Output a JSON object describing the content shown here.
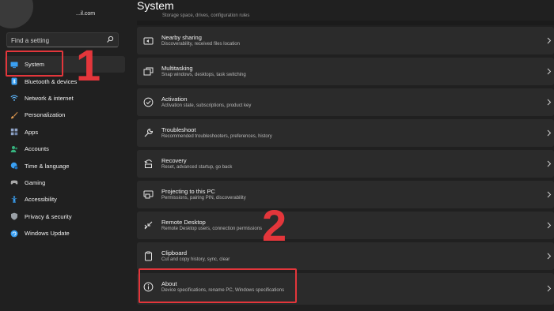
{
  "account": {
    "email": "...il.com"
  },
  "search": {
    "placeholder": "Find a setting",
    "icon": "search-icon"
  },
  "sidebar": {
    "items": [
      {
        "label": "System",
        "icon": "system-icon",
        "color": "#3aa0f3",
        "active": true
      },
      {
        "label": "Bluetooth & devices",
        "icon": "bluetooth-icon",
        "color": "#3aa0f3"
      },
      {
        "label": "Network & internet",
        "icon": "wifi-icon",
        "color": "#5eb8ff"
      },
      {
        "label": "Personalization",
        "icon": "brush-icon",
        "color": "#e8a052"
      },
      {
        "label": "Apps",
        "icon": "apps-icon",
        "color": "#8fa3c6"
      },
      {
        "label": "Accounts",
        "icon": "account-icon",
        "color": "#36b37e"
      },
      {
        "label": "Time & language",
        "icon": "globe-clock-icon",
        "color": "#3aa0f3"
      },
      {
        "label": "Gaming",
        "icon": "gamepad-icon",
        "color": "#a8a8a8"
      },
      {
        "label": "Accessibility",
        "icon": "accessibility-icon",
        "color": "#3aa0f3"
      },
      {
        "label": "Privacy & security",
        "icon": "shield-icon",
        "color": "#9aa0a6"
      },
      {
        "label": "Windows Update",
        "icon": "update-icon",
        "color": "#3aa0f3"
      }
    ]
  },
  "main": {
    "title": "System",
    "top_partial_desc": "Storage space, drives, configuration rules",
    "rows": [
      {
        "title": "Nearby sharing",
        "desc": "Discoverability, received files location",
        "icon": "nearby-sharing-icon"
      },
      {
        "title": "Multitasking",
        "desc": "Snap windows, desktops, task switching",
        "icon": "multitasking-icon"
      },
      {
        "title": "Activation",
        "desc": "Activation state, subscriptions, product key",
        "icon": "activation-icon"
      },
      {
        "title": "Troubleshoot",
        "desc": "Recommended troubleshooters, preferences, history",
        "icon": "wrench-icon"
      },
      {
        "title": "Recovery",
        "desc": "Reset, advanced startup, go back",
        "icon": "recovery-icon"
      },
      {
        "title": "Projecting to this PC",
        "desc": "Permissions, pairing PIN, discoverability",
        "icon": "projecting-icon"
      },
      {
        "title": "Remote Desktop",
        "desc": "Remote Desktop users, connection permissions",
        "icon": "remote-desktop-icon"
      },
      {
        "title": "Clipboard",
        "desc": "Cut and copy history, sync, clear",
        "icon": "clipboard-icon"
      },
      {
        "title": "About",
        "desc": "Device specifications, rename PC, Windows specifications",
        "icon": "info-icon"
      }
    ]
  },
  "annotations": {
    "step1": "1",
    "step2": "2",
    "color": "#e3363b"
  }
}
